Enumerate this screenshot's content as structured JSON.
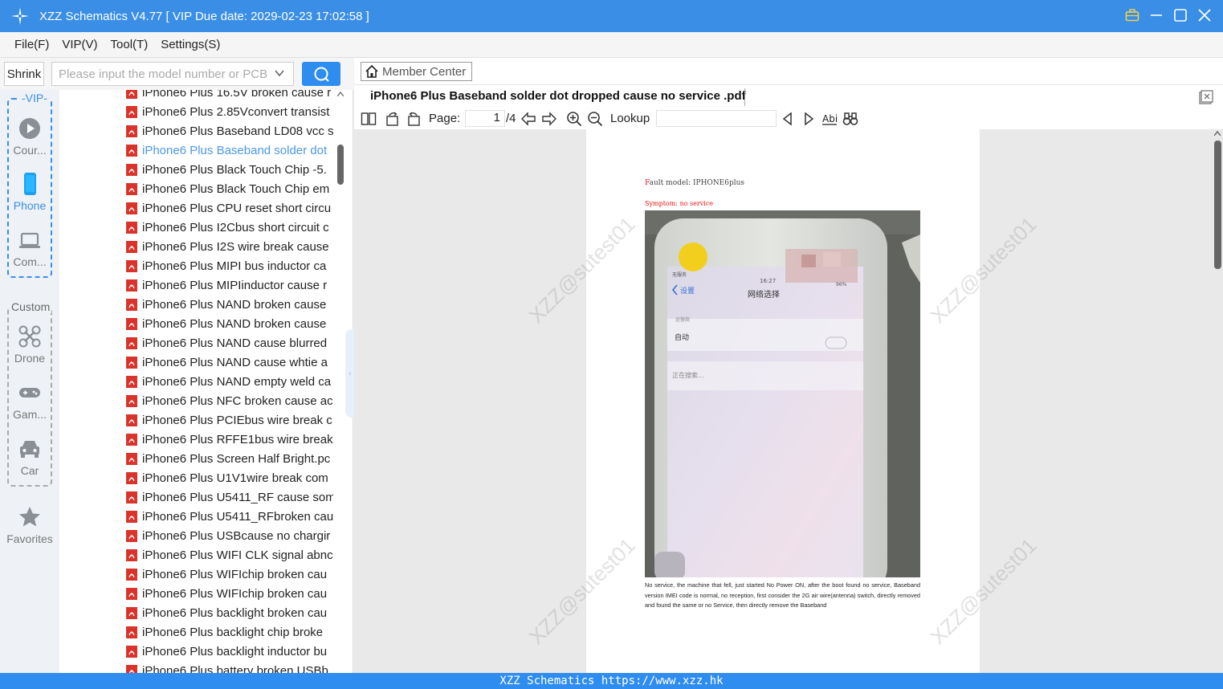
{
  "window": {
    "title": "XZZ Schematics V4.77 [ VIP Due date: 2029-02-23 17:02:58 ]",
    "accent": "#3a8ee6"
  },
  "menu": [
    "File(F)",
    "VIP(V)",
    "Tool(T)",
    "Settings(S)"
  ],
  "search": {
    "shrink_label": "Shrink",
    "placeholder": "Please input the model number or PCB"
  },
  "categories": {
    "vip_label": "-VIP-",
    "custom_label": "Custom",
    "items": [
      {
        "label": "Cour...",
        "icon": "play-circle-icon"
      },
      {
        "label": "Phone",
        "icon": "phone-icon"
      },
      {
        "label": "Com...",
        "icon": "laptop-icon"
      },
      {
        "label": "Drone",
        "icon": "drone-icon"
      },
      {
        "label": "Gam...",
        "icon": "gamepad-icon"
      },
      {
        "label": "Car",
        "icon": "car-icon"
      },
      {
        "label": "Favorites",
        "icon": "star-icon"
      }
    ]
  },
  "files": [
    "iPhone6 Plus 16.5V broken cause r",
    "iPhone6 Plus 2.85Vconvert transist",
    "iPhone6 Plus Baseband LD08 vcc s",
    "iPhone6 Plus Baseband solder dot",
    "iPhone6 Plus Black Touch Chip -5.",
    "iPhone6 Plus Black Touch Chip em",
    "iPhone6 Plus CPU reset short circu",
    "iPhone6 Plus I2Cbus short circuit c",
    "iPhone6 Plus I2S wire break  cause",
    "iPhone6 Plus MIPI bus inductor ca",
    "iPhone6 Plus MIPIinductor cause r",
    "iPhone6 Plus NAND broken cause",
    "iPhone6 Plus NAND broken cause",
    "iPhone6 Plus NAND cause blurred",
    "iPhone6 Plus NAND cause whtie a",
    "iPhone6 Plus NAND empty weld ca",
    "iPhone6 Plus NFC broken cause ac",
    "iPhone6 Plus PCIEbus wire break  c",
    "iPhone6 Plus RFFE1bus wire break",
    "iPhone6 Plus Screen Half Bright.pc",
    "iPhone6 Plus U1V1wire break  com",
    "iPhone6 Plus U5411_RF cause som",
    "iPhone6 Plus U5411_RFbroken cau",
    "iPhone6 Plus USBcause no chargir",
    "iPhone6 Plus WIFI CLK signal abnc",
    "iPhone6 Plus WIFIchip broken cau",
    "iPhone6 Plus WIFIchip broken cau",
    "iPhone6 Plus backlight broken cau",
    "iPhone6 Plus backlight chip broke",
    "iPhone6 Plus backlight inductor bu",
    "iPhone6 Plus battery broken USBb"
  ],
  "selected_file_index": 3,
  "viewer": {
    "member_center": "Member Center",
    "doc_tab": "iPhone6 Plus Baseband solder dot dropped cause no service  .pdf",
    "page_label": "Page:",
    "page_current": "1",
    "page_total": "/4",
    "lookup_label": "Lookup"
  },
  "document": {
    "fault_prefix": "F",
    "fault_rest": "ault model: IPHONE6plus",
    "symptom": "Symptom: no service",
    "screen_status_left": "无服务",
    "screen_time": "16:27",
    "screen_battery": "96%",
    "screen_back": "设置",
    "screen_title": "网络选择",
    "screen_carrier": "运营商",
    "screen_auto": "自动",
    "screen_searching": "正在搜索...",
    "description": "No service, the machine that fell, just started No Power ON, after the boot found no service, Baseband version IMEI code is normal, no reception, first consider the 2G air wire(antenna) switch, directly removed and found the same or no Service, then directly remove the Baseband",
    "watermark": "XZZ@sutest01"
  },
  "status_bar": "XZZ Schematics https://www.xzz.hk"
}
